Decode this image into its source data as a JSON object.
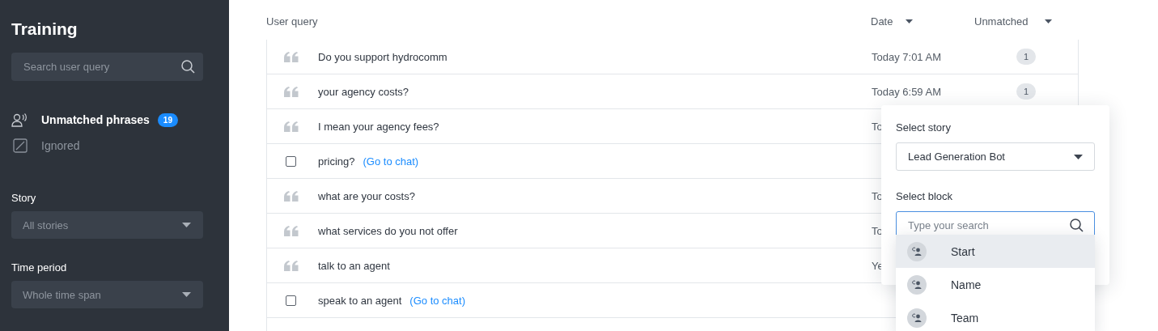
{
  "sidebar": {
    "title": "Training",
    "search": {
      "placeholder": "Search user query"
    },
    "nav": [
      {
        "kind": "unmatched",
        "label": "Unmatched phrases",
        "selected": true,
        "badge": "19"
      },
      {
        "kind": "ignored",
        "label": "Ignored",
        "selected": false
      }
    ],
    "filters": [
      {
        "label": "Story",
        "value": "All stories"
      },
      {
        "label": "Time period",
        "value": "Whole time span"
      }
    ]
  },
  "table": {
    "columns": [
      "User query",
      "Date",
      "Unmatched"
    ],
    "rows": [
      {
        "kind": "quote",
        "query": "Do you support hydrocomm",
        "date": "Today 7:01 AM",
        "unmatched": "1"
      },
      {
        "kind": "quote",
        "query": "your agency costs?",
        "date": "Today 6:59 AM",
        "unmatched": "1"
      },
      {
        "kind": "quote",
        "query": "I mean your agency fees?",
        "date": "To"
      },
      {
        "kind": "checkbox",
        "checked": false,
        "query": "pricing?",
        "link": "(Go to chat)"
      },
      {
        "kind": "quote",
        "query": "what are your costs?",
        "date": "To"
      },
      {
        "kind": "quote",
        "query": "what services do you not offer",
        "date": "To"
      },
      {
        "kind": "quote",
        "query": "talk to an agent",
        "date": "Ye"
      },
      {
        "kind": "checkbox",
        "checked": false,
        "query": "speak to an agent",
        "link": "(Go to chat)"
      }
    ]
  },
  "popup": {
    "story_label": "Select story",
    "story_value": "Lead Generation Bot",
    "block_label": "Select block",
    "search": {
      "placeholder": "Type your search"
    },
    "blocks": [
      {
        "label": "Start",
        "selected": true
      },
      {
        "label": "Name",
        "selected": false
      },
      {
        "label": "Team",
        "selected": false
      }
    ]
  }
}
